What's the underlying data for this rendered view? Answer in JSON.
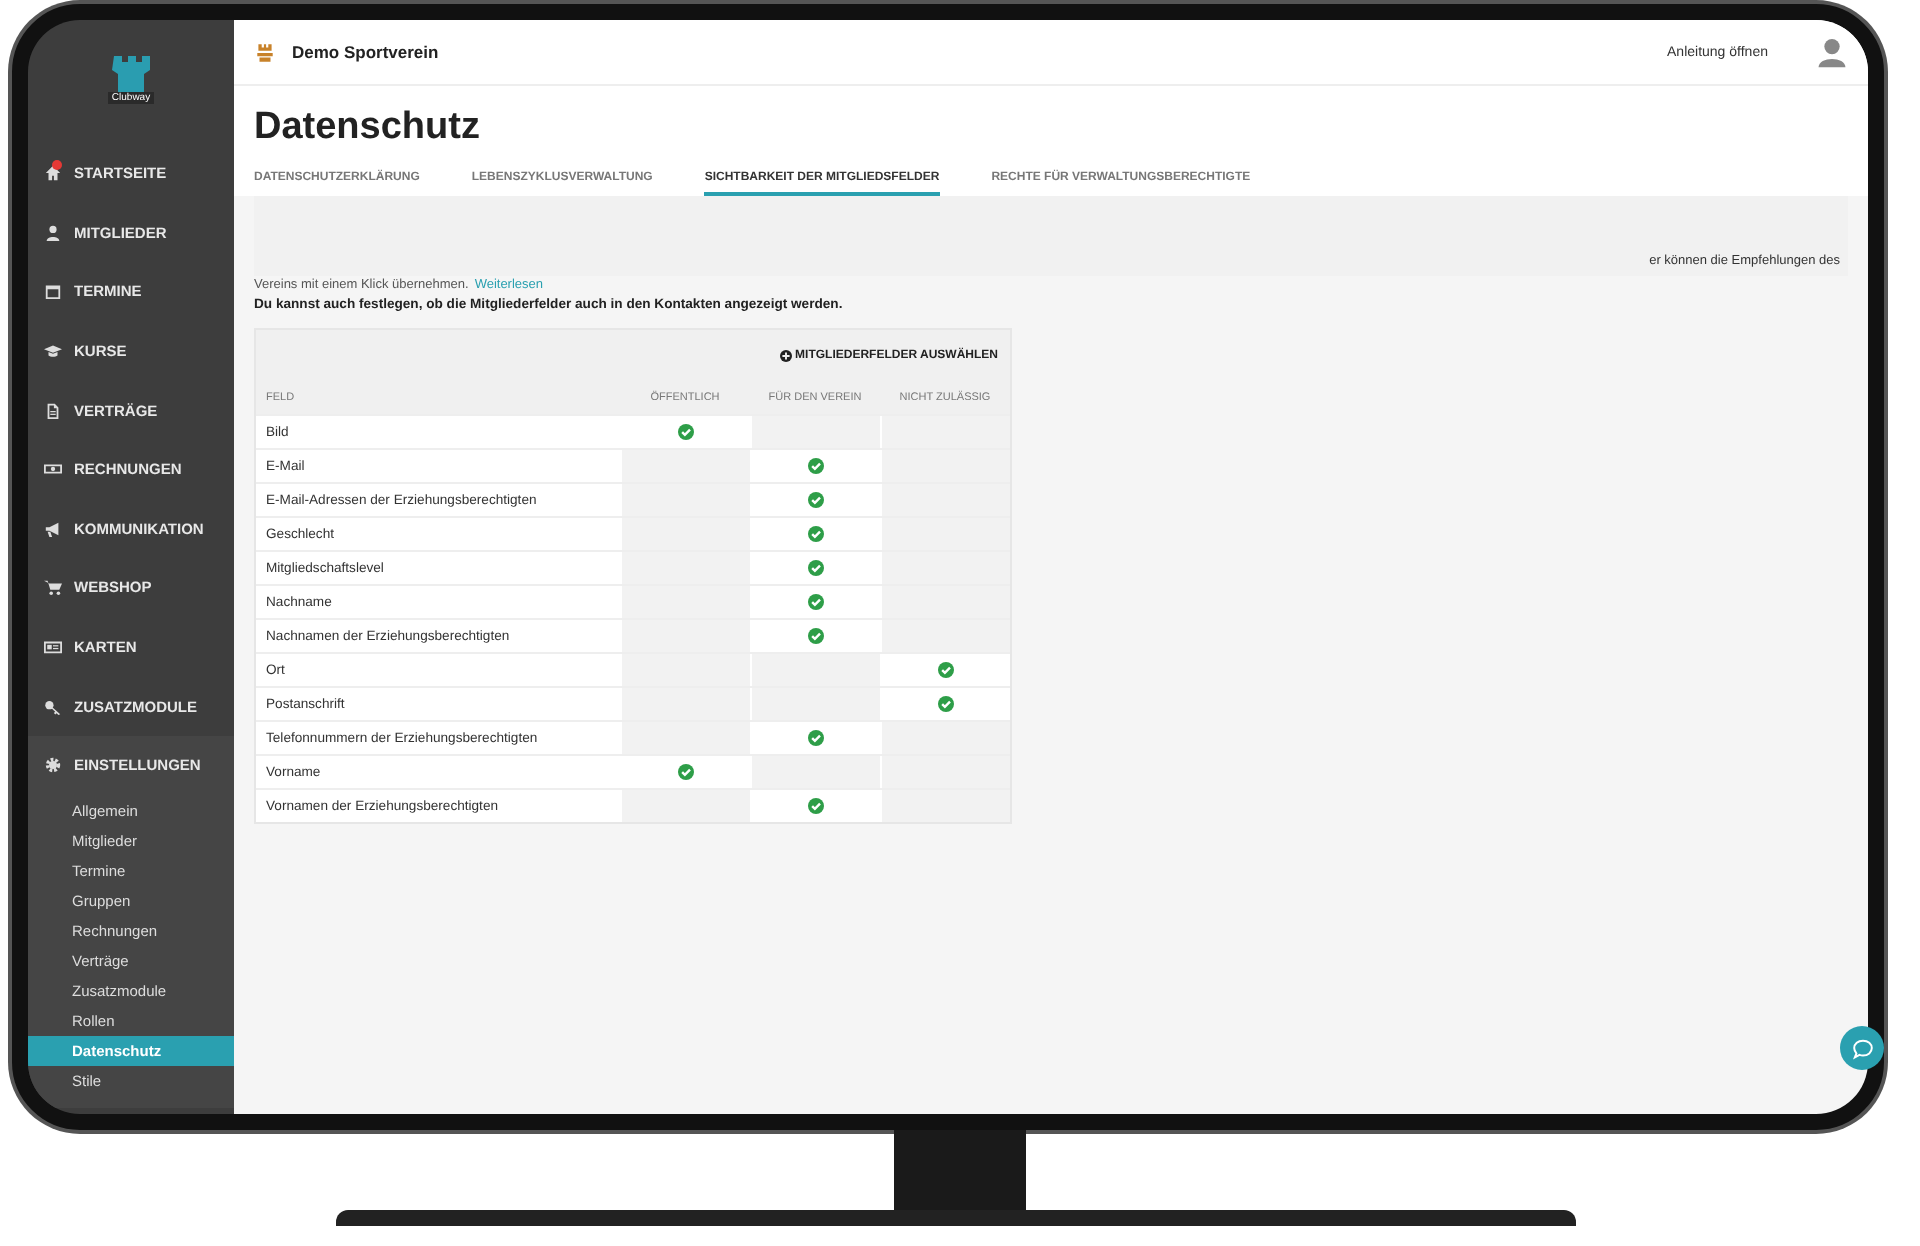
{
  "sidebar": {
    "logo": "Clubway",
    "items": [
      {
        "label": "STARTSEITE",
        "notification": true
      },
      {
        "label": "MITGLIEDER",
        "notification": false
      },
      {
        "label": "TERMINE",
        "notification": false
      },
      {
        "label": "KURSE",
        "notification": false
      },
      {
        "label": "VERTRÄGE",
        "notification": false
      },
      {
        "label": "RECHNUNGEN",
        "notification": false
      },
      {
        "label": "KOMMUNIKATION",
        "notification": false
      },
      {
        "label": "WEBSHOP",
        "notification": false
      },
      {
        "label": "KARTEN",
        "notification": false
      },
      {
        "label": "ZUSATZMODULE",
        "notification": false
      },
      {
        "label": "EINSTELLUNGEN",
        "notification": false,
        "expanded": true,
        "children": [
          {
            "label": "Allgemein",
            "selected": false
          },
          {
            "label": "Mitglieder",
            "selected": false
          },
          {
            "label": "Termine",
            "selected": false
          },
          {
            "label": "Gruppen",
            "selected": false
          },
          {
            "label": "Rechnungen",
            "selected": false
          },
          {
            "label": "Verträge",
            "selected": false
          },
          {
            "label": "Zusatzmodule",
            "selected": false
          },
          {
            "label": "Rollen",
            "selected": false
          },
          {
            "label": "Datenschutz",
            "selected": true
          },
          {
            "label": "Stile",
            "selected": false
          }
        ]
      }
    ]
  },
  "topbar": {
    "club": "Demo Sportverein",
    "help_link": "Anleitung öffnen"
  },
  "page_title": "Datenschutz",
  "tabs": [
    {
      "label": "DATENSCHUTZERKLÄRUNG",
      "selected": false
    },
    {
      "label": "LEBENSZYKLUSVERWALTUNG",
      "selected": false
    },
    {
      "label": "SICHTBARKEIT DER MITGLIEDSFELDER",
      "selected": true
    },
    {
      "label": "RECHTE FÜR VERWALTUNGSBERECHTIGTE",
      "selected": false
    }
  ],
  "notice": {
    "right_text": "er können die Empfehlungen des",
    "cut_text": "Vereins mit einem Klick übernehmen.",
    "link": "Weiterlesen"
  },
  "intro": "Du kannst auch festlegen, ob die Mitgliederfelder auch in den Kontakten angezeigt werden.",
  "table": {
    "action": "MITGLIEDERFELDER AUSWÄHLEN",
    "columns": [
      "FELD",
      "ÖFFENTLICH",
      "FÜR DEN VEREIN",
      "NICHT ZULÄSSIG"
    ],
    "rows": [
      {
        "field": "Bild",
        "options": [
          {
            "selected": true
          },
          {
            "selected": false
          },
          {
            "selected": false
          }
        ]
      },
      {
        "field": "E-Mail",
        "options": [
          {
            "selected": false
          },
          {
            "selected": true
          },
          {
            "selected": false
          }
        ]
      },
      {
        "field": "E-Mail-Adressen der Erziehungsberechtigten",
        "options": [
          {
            "selected": false
          },
          {
            "selected": true
          },
          {
            "selected": false
          }
        ]
      },
      {
        "field": "Geschlecht",
        "options": [
          {
            "selected": false
          },
          {
            "selected": true
          },
          {
            "selected": false
          }
        ]
      },
      {
        "field": "Mitgliedschaftslevel",
        "options": [
          {
            "selected": false
          },
          {
            "selected": true
          },
          {
            "selected": false
          }
        ]
      },
      {
        "field": "Nachname",
        "options": [
          {
            "selected": false
          },
          {
            "selected": true
          },
          {
            "selected": false
          }
        ]
      },
      {
        "field": "Nachnamen der Erziehungsberechtigten",
        "options": [
          {
            "selected": false
          },
          {
            "selected": true
          },
          {
            "selected": false
          }
        ]
      },
      {
        "field": "Ort",
        "options": [
          {
            "selected": false
          },
          {
            "selected": false
          },
          {
            "selected": true
          }
        ]
      },
      {
        "field": "Postanschrift",
        "options": [
          {
            "selected": false
          },
          {
            "selected": false
          },
          {
            "selected": true
          }
        ]
      },
      {
        "field": "Telefonnummern der Erziehungsberechtigten",
        "options": [
          {
            "selected": false
          },
          {
            "selected": true
          },
          {
            "selected": false
          }
        ]
      },
      {
        "field": "Vorname",
        "options": [
          {
            "selected": true
          },
          {
            "selected": false
          },
          {
            "selected": false
          }
        ]
      },
      {
        "field": "Vornamen der Erziehungsberechtigten",
        "options": [
          {
            "selected": false
          },
          {
            "selected": true
          },
          {
            "selected": false
          }
        ]
      }
    ]
  }
}
